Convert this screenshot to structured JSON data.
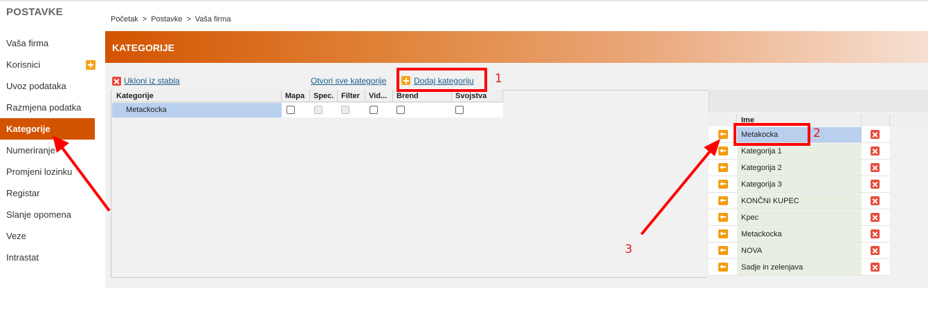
{
  "sidebar": {
    "title": "POSTAVKE",
    "items": [
      {
        "label": "Vaša firma"
      },
      {
        "label": "Korisnici"
      },
      {
        "label": "Uvoz podataka"
      },
      {
        "label": "Razmjena podatka"
      },
      {
        "label": "Kategorije",
        "active": true
      },
      {
        "label": "Numeriranje"
      },
      {
        "label": "Promjeni lozinku"
      },
      {
        "label": "Registar"
      },
      {
        "label": "Slanje opomena"
      },
      {
        "label": "Veze"
      },
      {
        "label": "Intrastat"
      }
    ]
  },
  "breadcrumb": {
    "items": [
      "Početak",
      "Postavke",
      "Vaša firma"
    ],
    "separator": ">"
  },
  "header": {
    "title": "KATEGORIJE"
  },
  "toolbar": {
    "remove_label": "Ukloni iz stabla",
    "open_all_label": "Otvori sve kategorije",
    "add_label": "Dodaj kategoriju"
  },
  "tree_table": {
    "columns": [
      "Kategorije",
      "Mapa",
      "Spec.",
      "Filter",
      "Vid...",
      "Brend",
      "Svojstva"
    ],
    "rows": [
      {
        "name": "Metackocka",
        "mapa": false,
        "spec": false,
        "filter": false,
        "vid": false,
        "brend": false,
        "svojstva": false
      }
    ]
  },
  "category_list": {
    "column": "Ime",
    "items": [
      {
        "name": "Metakocka",
        "selected": true
      },
      {
        "name": "Kategorija 1"
      },
      {
        "name": "Kategorija 2"
      },
      {
        "name": "Kategorija 3"
      },
      {
        "name": "KONČNI KUPEC"
      },
      {
        "name": "Kpec"
      },
      {
        "name": "Metackocka"
      },
      {
        "name": "NOVA"
      },
      {
        "name": "Sadje in zelenjava"
      }
    ]
  },
  "annotations": {
    "labels": [
      "1",
      "2",
      "3"
    ],
    "color": "#ff0000"
  },
  "colors": {
    "accent": "#d35400",
    "link": "#1a5e8a",
    "selection": "#b9cfee"
  }
}
